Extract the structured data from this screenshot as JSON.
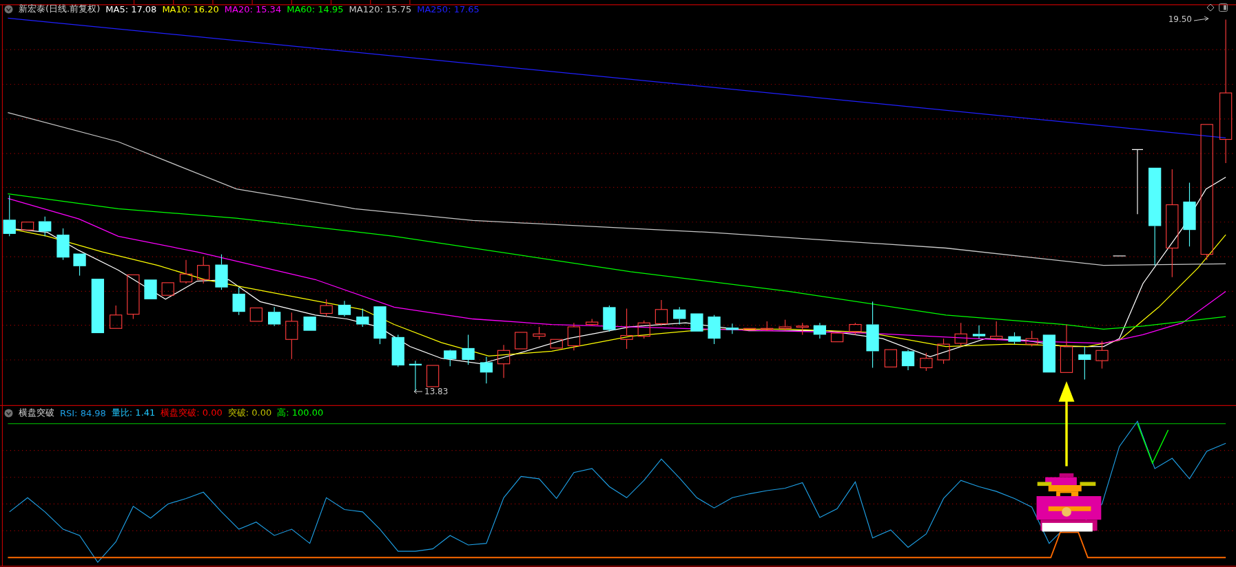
{
  "price_panel": {
    "title": "新宏泰(日线.前复权)",
    "averages": [
      {
        "label": "MA5: 17.08",
        "color": "#ffffff"
      },
      {
        "label": "MA10: 16.20",
        "color": "#ffff00"
      },
      {
        "label": "MA20: 15.34",
        "color": "#ff00ff"
      },
      {
        "label": "MA60: 14.95",
        "color": "#00ff00"
      },
      {
        "label": "MA120: 15.75",
        "color": "#c8c8c8"
      },
      {
        "label": "MA250: 17.65",
        "color": "#2020ff"
      }
    ],
    "high_label": "19.50",
    "low_label": "13.83"
  },
  "indicator_panel": {
    "title": "横盘突破",
    "values": [
      {
        "label": "RSI: 84.98",
        "color": "#1ea0e6"
      },
      {
        "label": "量比: 1.41",
        "color": "#20c8ff"
      },
      {
        "label": "横盘突破: 0.00",
        "color": "#ff0000"
      },
      {
        "label": "突破: 0.00",
        "color": "#c0c000"
      },
      {
        "label": "高: 100.00",
        "color": "#00ff00"
      }
    ]
  }
}
